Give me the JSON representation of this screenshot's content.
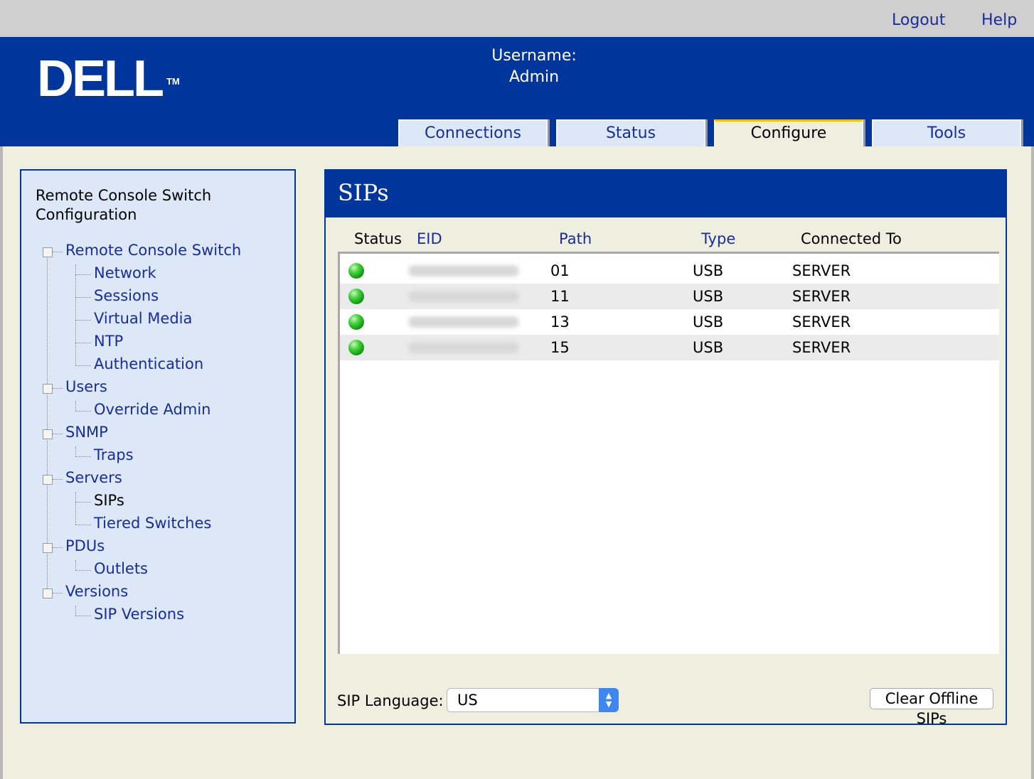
{
  "topbar": {
    "logout": "Logout",
    "help": "Help"
  },
  "header": {
    "logo": "DELL",
    "logo_tm": "TM",
    "username_label": "Username:",
    "username_value": "Admin"
  },
  "tabs": [
    {
      "label": "Connections"
    },
    {
      "label": "Status"
    },
    {
      "label": "Configure",
      "active": true
    },
    {
      "label": "Tools"
    }
  ],
  "sidebar": {
    "title_line1": "Remote Console Switch",
    "title_line2": "Configuration",
    "items": [
      {
        "label": "Remote Console Switch"
      },
      {
        "label": "Network"
      },
      {
        "label": "Sessions"
      },
      {
        "label": "Virtual Media"
      },
      {
        "label": "NTP"
      },
      {
        "label": "Authentication"
      },
      {
        "label": "Users"
      },
      {
        "label": "Override Admin"
      },
      {
        "label": "SNMP"
      },
      {
        "label": "Traps"
      },
      {
        "label": "Servers"
      },
      {
        "label": "SIPs",
        "current": true
      },
      {
        "label": "Tiered Switches"
      },
      {
        "label": "PDUs"
      },
      {
        "label": "Outlets"
      },
      {
        "label": "Versions"
      },
      {
        "label": "SIP Versions"
      }
    ]
  },
  "main": {
    "title": "SIPs",
    "columns": {
      "status": "Status",
      "eid": "EID",
      "path": "Path",
      "type": "Type",
      "connected_to": "Connected To"
    },
    "rows": [
      {
        "status": "online",
        "path": "01",
        "type": "USB",
        "connected_to": "SERVER"
      },
      {
        "status": "online",
        "path": "11",
        "type": "USB",
        "connected_to": "SERVER"
      },
      {
        "status": "online",
        "path": "13",
        "type": "USB",
        "connected_to": "SERVER"
      },
      {
        "status": "online",
        "path": "15",
        "type": "USB",
        "connected_to": "SERVER"
      }
    ],
    "language_label": "SIP Language:",
    "language_value": "US",
    "clear_button": "Clear Offline SIPs"
  },
  "colors": {
    "header_blue": "#00369c",
    "panel_blue": "#dce8f8",
    "link_blue": "#1a2d96",
    "active_tab_accent": "#f4c200",
    "status_green": "#3fd23a"
  },
  "icons": {
    "status": "green-status-dot-icon",
    "select": "up-down-chevron-icon",
    "tree_node": "tree-expander-icon"
  }
}
